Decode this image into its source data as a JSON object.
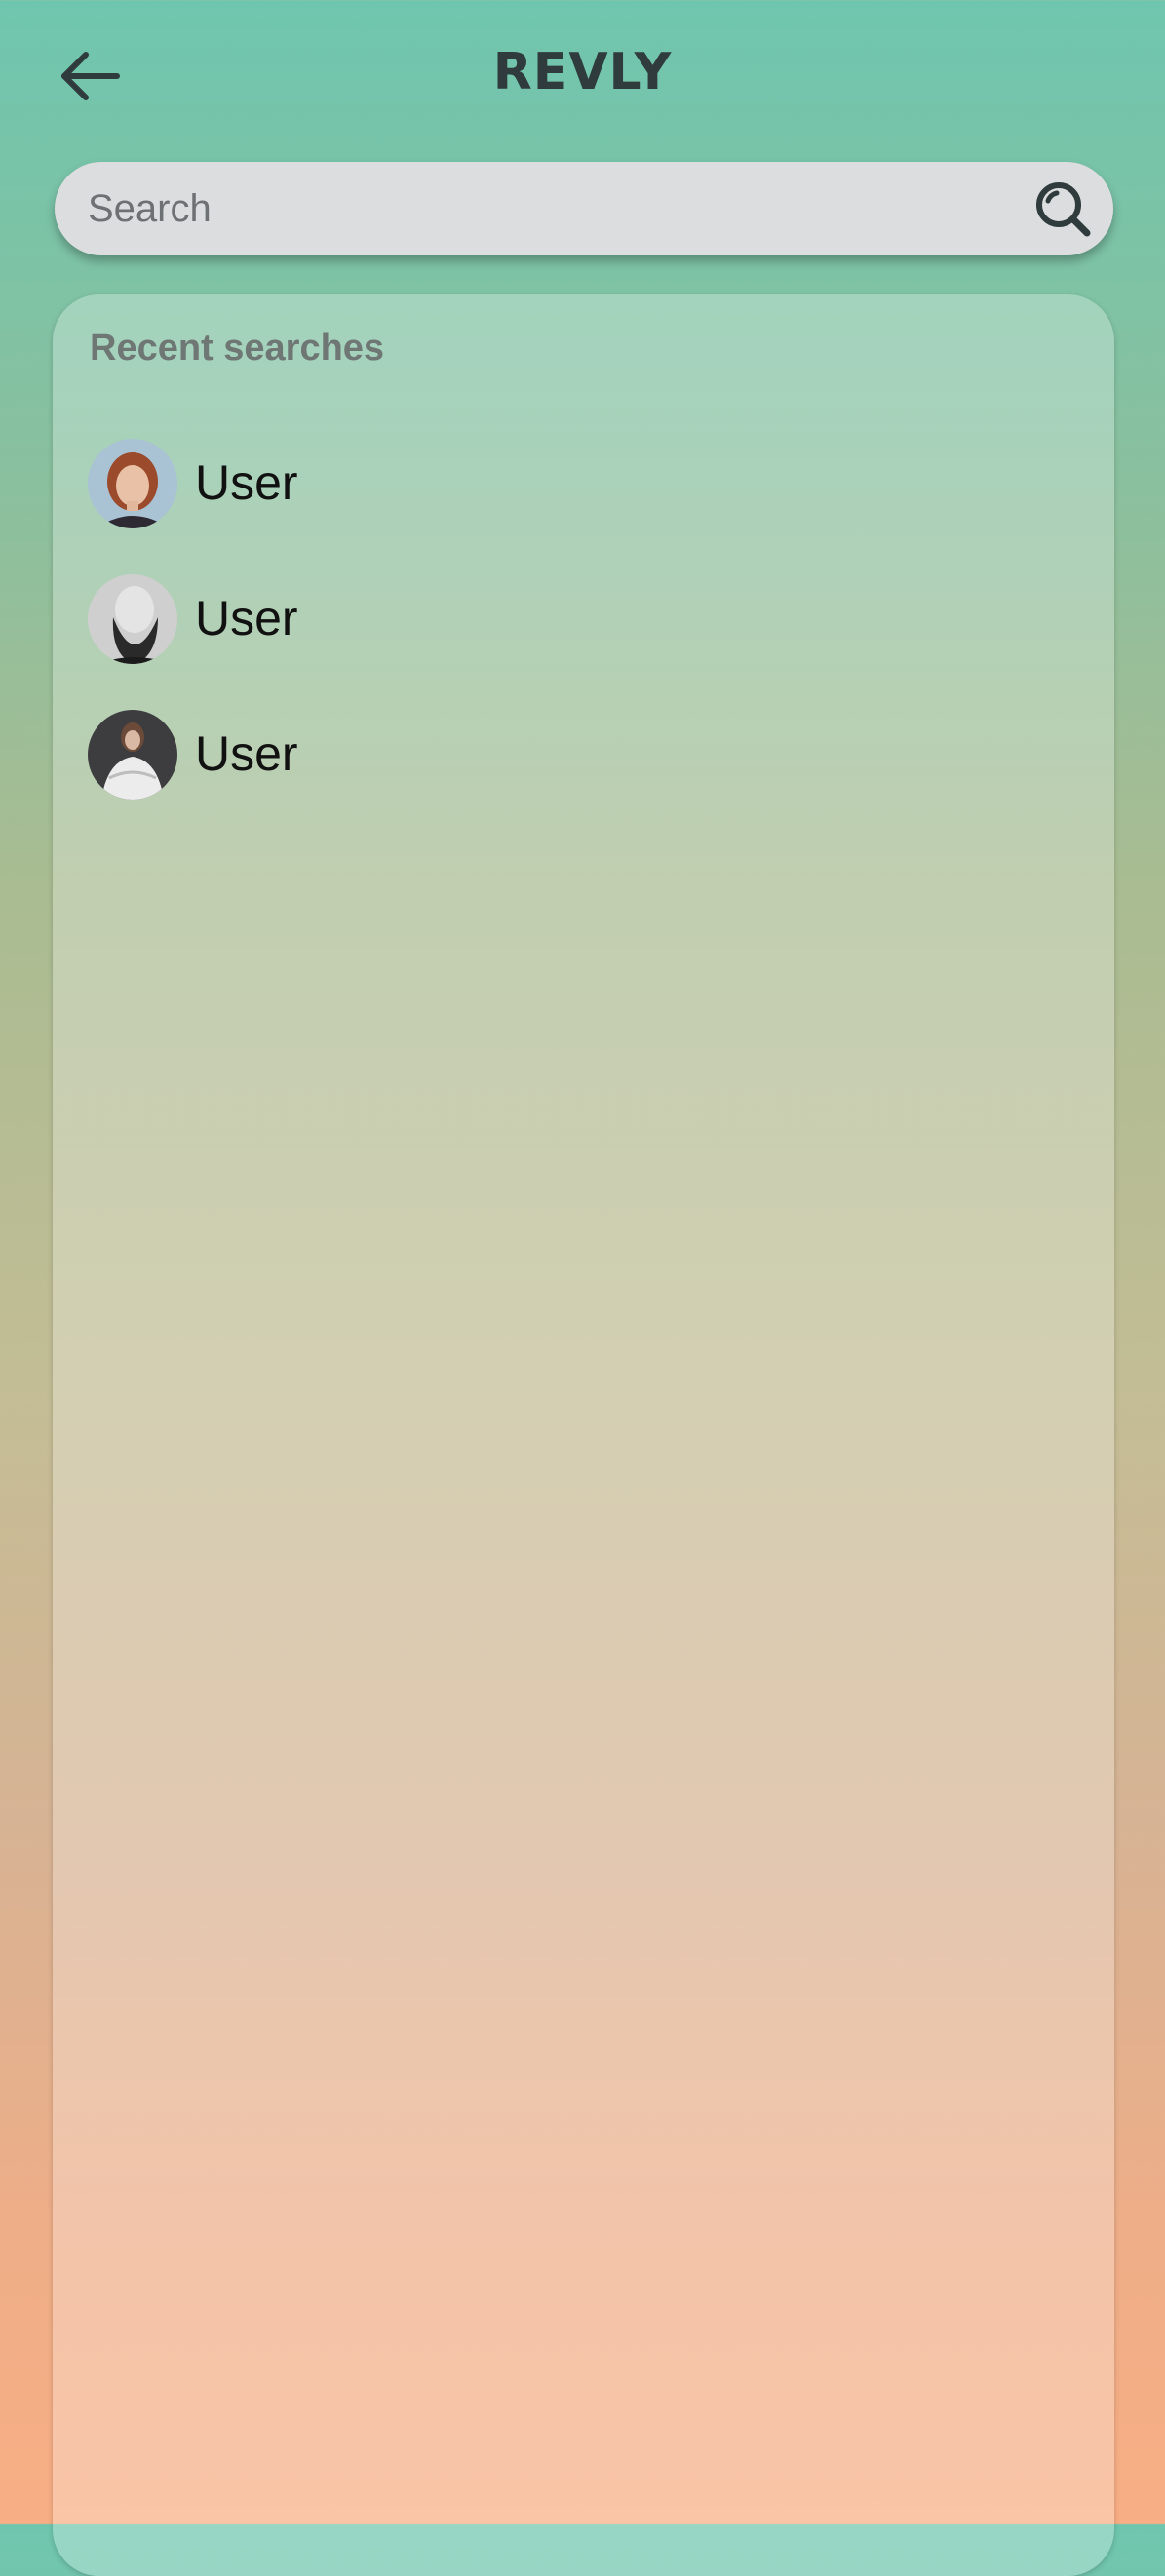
{
  "header": {
    "title": "REVLY",
    "back_icon": "arrow-left-icon"
  },
  "search": {
    "placeholder": "Search",
    "value": "",
    "icon": "search-icon"
  },
  "recent": {
    "title": "Recent searches",
    "items": [
      {
        "name": "User",
        "avatar": "woman-red-hair-photo"
      },
      {
        "name": "User",
        "avatar": "bearded-man-bw-photo"
      },
      {
        "name": "User",
        "avatar": "woman-white-dress-photo"
      }
    ]
  },
  "colors": {
    "gradient_top": "#6fc6ae",
    "gradient_bottom": "#f8ae84",
    "title_text": "#2f3b3d",
    "search_bg": "#dcdddf"
  }
}
